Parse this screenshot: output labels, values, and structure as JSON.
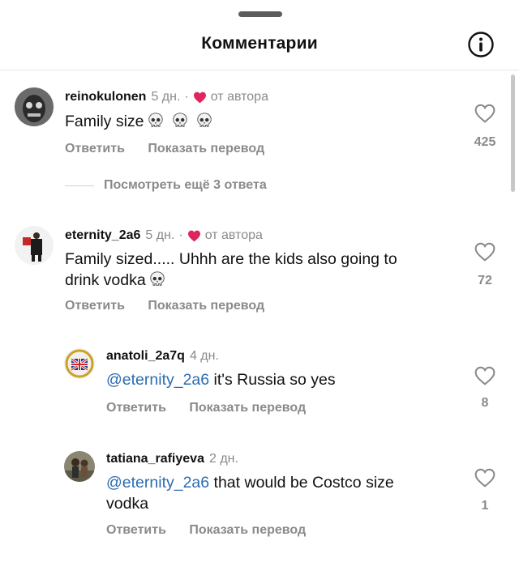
{
  "header": {
    "title": "Комментарии"
  },
  "comments": [
    {
      "username": "reinokulonen",
      "time": "5 дн.",
      "by_author": "от автора",
      "text": "Family size",
      "likes": "425",
      "reply": "Ответить",
      "translate": "Показать перевод"
    },
    {
      "username": "eternity_2a6",
      "time": "5 дн.",
      "by_author": "от автора",
      "text_line1": "Family sized..... Uhhh are the kids also going to",
      "text_line2": "drink vodka",
      "likes": "72",
      "reply": "Ответить",
      "translate": "Показать перевод"
    }
  ],
  "view_more_replies": "Посмотреть ещё 3 ответа",
  "replies": [
    {
      "username": "anatoli_2a7q",
      "time": "4 дн.",
      "mention": "@eternity_2a6",
      "text": " it's Russia so yes",
      "likes": "8",
      "reply": "Ответить",
      "translate": "Показать перевод"
    },
    {
      "username": "tatiana_rafiyeva",
      "time": "2 дн.",
      "mention": "@eternity_2a6",
      "text_line1": " that would be Costco size",
      "text_line2": "vodka",
      "likes": "1",
      "reply": "Ответить",
      "translate": "Показать перевод"
    }
  ],
  "colors": {
    "heart_red": "#e0245e",
    "mention": "#2b6cb0",
    "muted": "#8a8a8a"
  }
}
